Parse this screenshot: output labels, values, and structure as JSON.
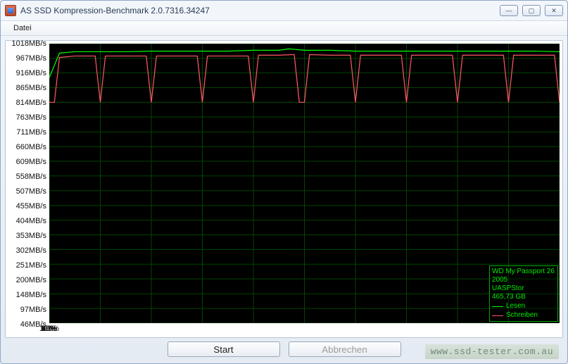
{
  "window": {
    "title": "AS SSD Kompression-Benchmark 2.0.7316.34247",
    "minimize_glyph": "—",
    "maximize_glyph": "▢",
    "close_glyph": "✕"
  },
  "menu": {
    "items": [
      "Datei"
    ]
  },
  "buttons": {
    "start": "Start",
    "abort": "Abbrechen"
  },
  "watermark": "www.ssd-tester.com.au",
  "device": {
    "name": "WD My Passport 26",
    "model": "2005",
    "driver": "UASPStor",
    "capacity": "465,73 GB"
  },
  "legend": {
    "read": "Lesen",
    "write": "Schreiben",
    "read_color": "#00ff00",
    "write_color": "#ff5566"
  },
  "chart_data": {
    "type": "line",
    "title": "",
    "xlabel": "",
    "ylabel": "",
    "x_unit": "%",
    "y_unit": "MB/s",
    "xlim": [
      0,
      100
    ],
    "ylim": [
      46,
      1018
    ],
    "y_ticks": [
      1018,
      967,
      916,
      865,
      814,
      763,
      711,
      660,
      609,
      558,
      507,
      455,
      404,
      353,
      302,
      251,
      200,
      148,
      97,
      46
    ],
    "y_tick_labels": [
      "1018MB/s",
      "967MB/s",
      "916MB/s",
      "865MB/s",
      "814MB/s",
      "763MB/s",
      "711MB/s",
      "660MB/s",
      "609MB/s",
      "558MB/s",
      "507MB/s",
      "455MB/s",
      "404MB/s",
      "353MB/s",
      "302MB/s",
      "251MB/s",
      "200MB/s",
      "148MB/s",
      "97MB/s",
      "46MB/s"
    ],
    "x_ticks": [
      0,
      10,
      20,
      30,
      40,
      50,
      60,
      70,
      80,
      90,
      100
    ],
    "x_tick_labels": [
      "0%",
      "10%",
      "20%",
      "30%",
      "40%",
      "50%",
      "60%",
      "70%",
      "80%",
      "90%",
      "100%"
    ],
    "series": [
      {
        "name": "Lesen",
        "color": "#00ff00",
        "x": [
          0,
          2,
          5,
          10,
          15,
          20,
          25,
          30,
          35,
          40,
          45,
          47,
          50,
          55,
          60,
          65,
          70,
          75,
          80,
          85,
          90,
          95,
          100
        ],
        "y": [
          900,
          985,
          990,
          990,
          990,
          992,
          992,
          992,
          992,
          995,
          995,
          1000,
          995,
          995,
          992,
          992,
          992,
          992,
          992,
          992,
          992,
          992,
          990
        ]
      },
      {
        "name": "Schreiben",
        "color": "#ff5566",
        "x": [
          0,
          1,
          2,
          5,
          9,
          10,
          11,
          15,
          19,
          20,
          21,
          25,
          29,
          30,
          31,
          35,
          39,
          40,
          41,
          45,
          48,
          49,
          50,
          51,
          55,
          59,
          60,
          61,
          65,
          69,
          70,
          71,
          75,
          79,
          80,
          81,
          85,
          89,
          90,
          91,
          95,
          99,
          100
        ],
        "y": [
          814,
          814,
          970,
          975,
          975,
          814,
          975,
          975,
          975,
          814,
          975,
          975,
          975,
          814,
          975,
          975,
          975,
          814,
          978,
          978,
          980,
          814,
          814,
          980,
          978,
          978,
          814,
          978,
          978,
          978,
          814,
          978,
          978,
          978,
          814,
          978,
          978,
          978,
          814,
          978,
          978,
          978,
          814
        ]
      }
    ]
  }
}
